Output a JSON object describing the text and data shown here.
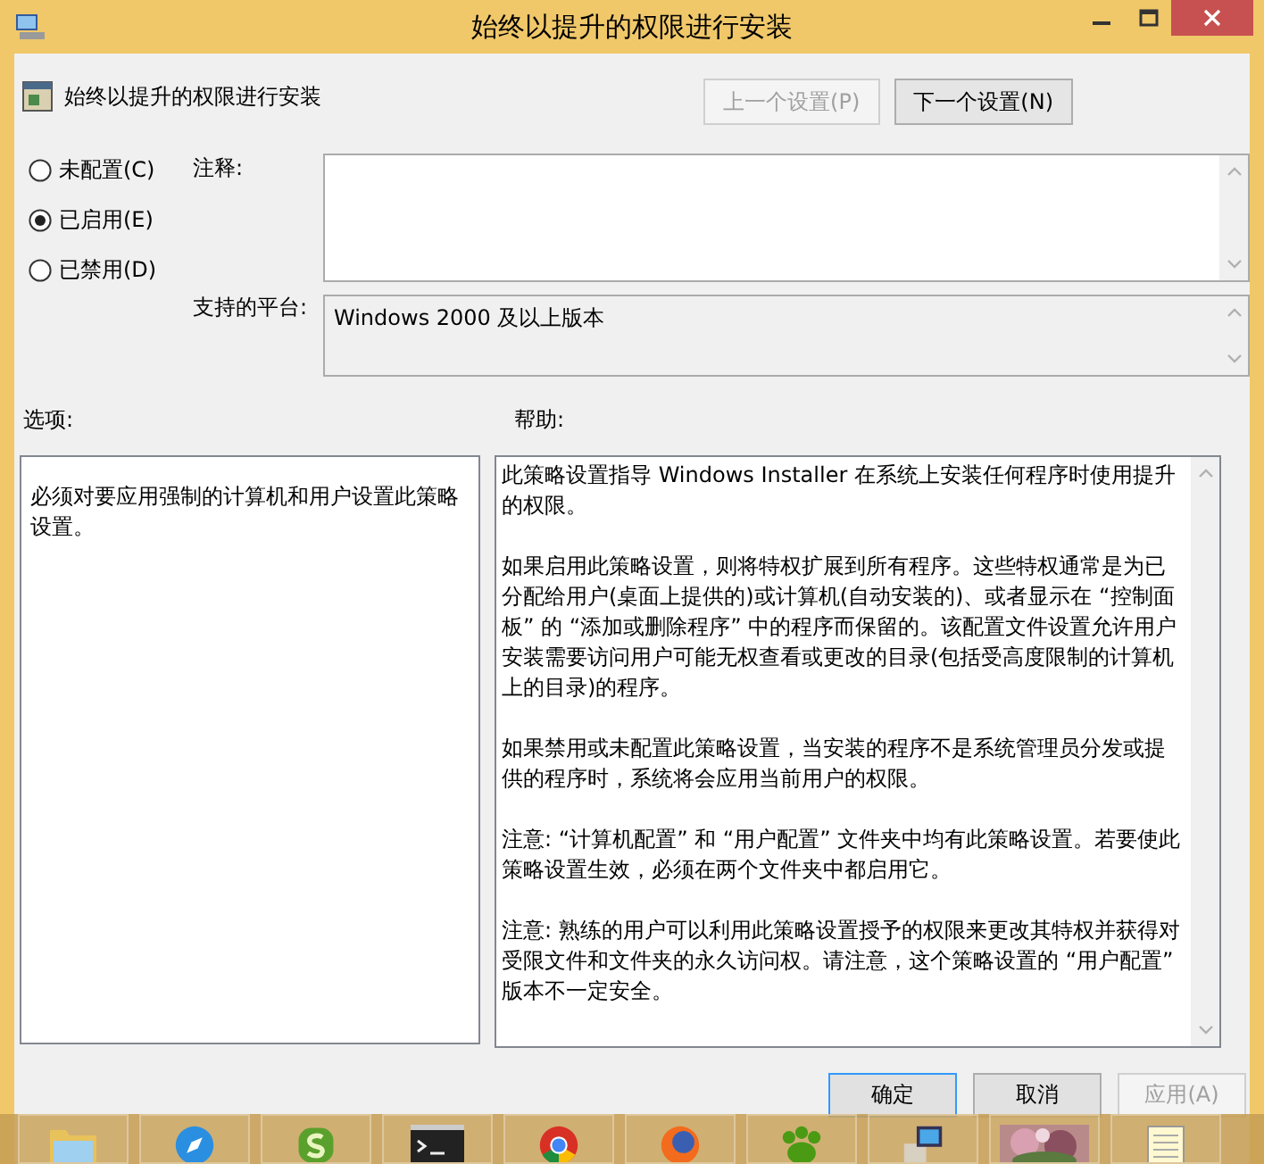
{
  "window": {
    "title": "始终以提升的权限进行安装"
  },
  "header": {
    "policy_name": "始终以提升的权限进行安装",
    "buttons": [
      {
        "label": "上一个设置(P)",
        "disabled": true
      },
      {
        "label": "下一个设置(N)",
        "disabled": false
      }
    ]
  },
  "states": [
    {
      "label": "未配置(C)",
      "selected": false
    },
    {
      "label": "已启用(E)",
      "selected": true
    },
    {
      "label": "已禁用(D)",
      "selected": false
    }
  ],
  "comment": {
    "label": "注释:"
  },
  "platform": {
    "label": "支持的平台:",
    "value": "Windows 2000 及以上版本"
  },
  "options": {
    "label": "选项:",
    "text": "必须对要应用强制的计算机和用户设置此策略设置。"
  },
  "help": {
    "label": "帮助:",
    "paragraphs": [
      "此策略设置指导 Windows Installer 在系统上安装任何程序时使用提升的权限。",
      "如果启用此策略设置，则将特权扩展到所有程序。这些特权通常是为已分配给用户(桌面上提供的)或计算机(自动安装的)、或者显示在 “控制面板” 的 “添加或删除程序” 中的程序而保留的。该配置文件设置允许用户安装需要访问用户可能无权查看或更改的目录(包括受高度限制的计算机上的目录)的程序。",
      "如果禁用或未配置此策略设置，当安装的程序不是系统管理员分发或提供的程序时，系统将会应用当前用户的权限。",
      "注意: “计算机配置” 和 “用户配置” 文件夹中均有此策略设置。若要使此策略设置生效，必须在两个文件夹中都启用它。",
      "注意: 熟练的用户可以利用此策略设置授予的权限来更改其特权并获得对受限文件和文件夹的永久访问权。请注意，这个策略设置的 “用户配置” 版本不一定安全。"
    ]
  },
  "footer_buttons": [
    {
      "label": "确定",
      "disabled": false
    },
    {
      "label": "取消",
      "disabled": false
    },
    {
      "label": "应用(A)",
      "disabled": true
    }
  ],
  "taskbar": {
    "items": [
      {
        "kind": "folder"
      },
      {
        "kind": "compass"
      },
      {
        "kind": "green-s"
      },
      {
        "kind": "terminal"
      },
      {
        "kind": "chrome"
      },
      {
        "kind": "firefox"
      },
      {
        "kind": "paw"
      },
      {
        "kind": "installer"
      },
      {
        "kind": "picture"
      },
      {
        "kind": "notepad"
      }
    ]
  }
}
